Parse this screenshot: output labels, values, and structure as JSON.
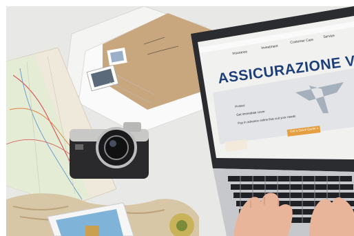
{
  "image": {
    "subject": "travel-planning-desk",
    "screen": {
      "nav_items": [
        "Insurance",
        "Investment",
        "Customer Care",
        "Service"
      ],
      "title": "ASSICURAZIONE VIAG",
      "bullets": [
        "Protect",
        "Get immediate cover",
        "Pay in advance online that suit your needs"
      ],
      "cta": "Get a Quick Quote  »"
    },
    "colors": {
      "table": "#e9e9e7",
      "laptop_body": "#2b2c30",
      "title_blue": "#1c3f79",
      "cta_orange": "#e4a040",
      "envelope": "#c9a77e"
    }
  }
}
